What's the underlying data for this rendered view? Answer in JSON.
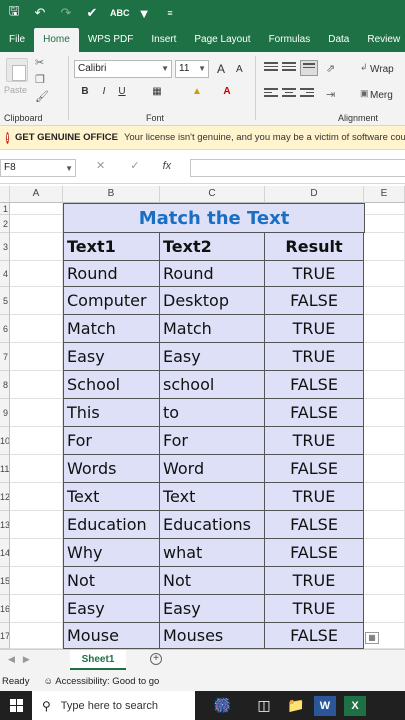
{
  "quick_access": {
    "icons": [
      "save-icon",
      "undo-icon",
      "redo-icon",
      "format-painter-icon",
      "abc-spell-icon",
      "filter-icon",
      "customize-icon"
    ]
  },
  "tabs": [
    "File",
    "Home",
    "WPS PDF",
    "Insert",
    "Page Layout",
    "Formulas",
    "Data",
    "Review"
  ],
  "ribbon": {
    "paste_label": "Paste",
    "clipboard_label": "Clipboard",
    "font_name": "Calibri",
    "font_size": "11",
    "grow_font": "A",
    "shrink_font": "A",
    "bold": "B",
    "italic": "I",
    "underline": "U",
    "font_group_label": "Font",
    "wrap_label": "Wrap",
    "merge_label": "Merg",
    "alignment_label": "Alignment"
  },
  "notice": {
    "title": "GET GENUINE OFFICE",
    "text": "Your license isn't genuine, and you may be a victim of software cou"
  },
  "formula_bar": {
    "name_box": "F8",
    "cancel": "✕",
    "enter": "✓",
    "fx": "fx",
    "value": ""
  },
  "columns": [
    "A",
    "B",
    "C",
    "D",
    "E"
  ],
  "rows": [
    "1",
    "2",
    "3",
    "4",
    "5",
    "6",
    "7",
    "8",
    "9",
    "10",
    "11",
    "12",
    "13",
    "14",
    "15",
    "16",
    "17"
  ],
  "table": {
    "title": "Match the Text",
    "headers": [
      "Text1",
      "Text2",
      "Result"
    ],
    "rows": [
      [
        "Round",
        "Round",
        "TRUE"
      ],
      [
        "Computer",
        "Desktop",
        "FALSE"
      ],
      [
        "Match",
        "Match",
        "TRUE"
      ],
      [
        "Easy",
        "Easy",
        "TRUE"
      ],
      [
        "School",
        "school",
        "FALSE"
      ],
      [
        "This",
        "to",
        "FALSE"
      ],
      [
        "For",
        "For",
        "TRUE"
      ],
      [
        "Words",
        "Word",
        "FALSE"
      ],
      [
        "Text",
        "Text",
        "TRUE"
      ],
      [
        "Education",
        "Educations",
        "FALSE"
      ],
      [
        "Why",
        "what",
        "FALSE"
      ],
      [
        "Not",
        "Not",
        "TRUE"
      ],
      [
        "Easy",
        "Easy",
        "TRUE"
      ],
      [
        "Mouse",
        "Mouses",
        "FALSE"
      ]
    ]
  },
  "sheet_tab": "Sheet1",
  "status": {
    "ready": "Ready",
    "accessibility": "Accessibility: Good to go"
  },
  "taskbar": {
    "search_placeholder": "Type here to search"
  },
  "colors": {
    "excel_green": "#1e7145",
    "table_fill": "#dde0f6",
    "title_blue": "#1b6ec2",
    "notice_bg": "#fff4ce"
  }
}
